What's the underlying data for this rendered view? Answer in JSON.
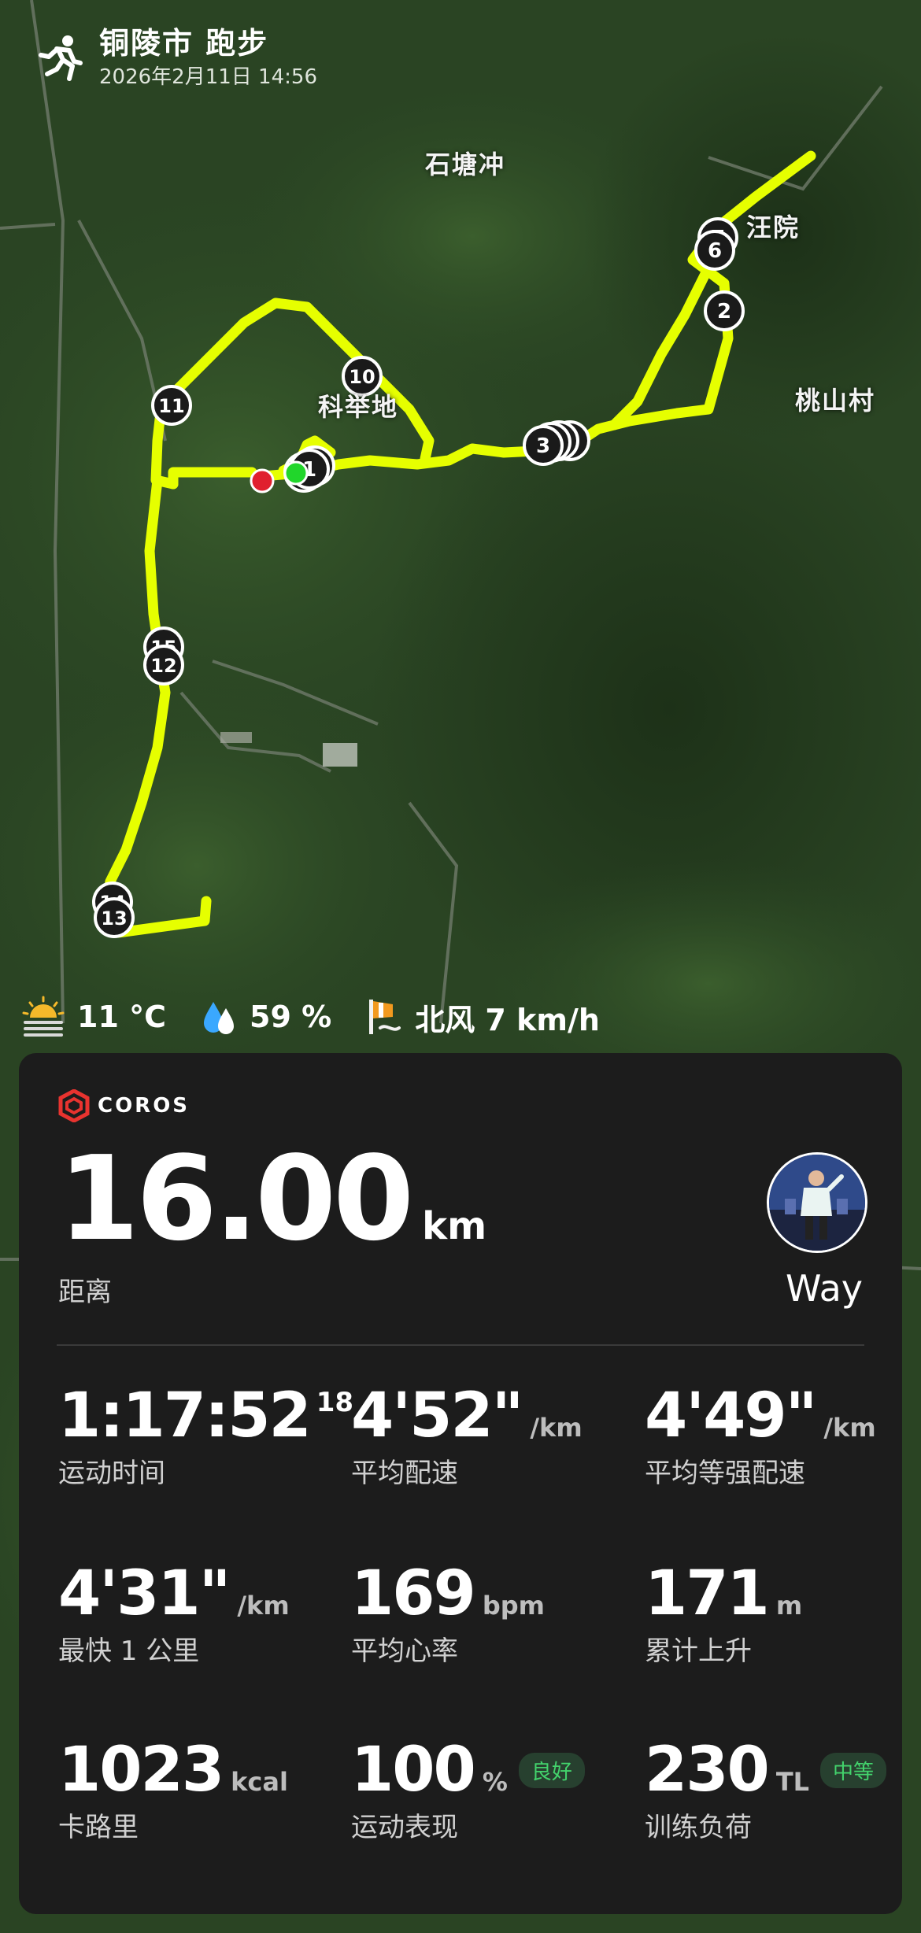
{
  "header": {
    "title": "铜陵市 跑步",
    "datetime": "2026年2月11日 14:56"
  },
  "map": {
    "place_names": [
      "石塘冲",
      "汪院",
      "桃山村",
      "科举地"
    ],
    "route_color": "#e6ff00",
    "markers": [
      "1",
      "2",
      "3",
      "4",
      "5",
      "6",
      "7",
      "8",
      "9",
      "10",
      "11",
      "12",
      "13",
      "14",
      "15",
      "16"
    ],
    "start_color": "#21d62b",
    "end_color": "#e0202e"
  },
  "weather": {
    "temperature": "11 °C",
    "humidity": "59 %",
    "wind": "北风 7 km/h"
  },
  "card": {
    "brand": "COROS",
    "distance_value": "16.00",
    "distance_unit": "km",
    "distance_label": "距离",
    "user_name": "Way",
    "stats": [
      {
        "value": "1:17:52",
        "sup": "18",
        "unit": "",
        "label": "运动时间"
      },
      {
        "value": "4'52\"",
        "unit": "/km",
        "label": "平均配速"
      },
      {
        "value": "4'49\"",
        "unit": "/km",
        "label": "平均等强配速"
      },
      {
        "value": "4'31\"",
        "unit": "/km",
        "label": "最快 1 公里"
      },
      {
        "value": "169",
        "unit": "bpm",
        "label": "平均心率"
      },
      {
        "value": "171",
        "unit": "m",
        "label": "累计上升"
      },
      {
        "value": "1023",
        "unit": "kcal",
        "label": "卡路里"
      },
      {
        "value": "100",
        "unit": "%",
        "badge": "良好",
        "label": "运动表现"
      },
      {
        "value": "230",
        "unit": "TL",
        "badge": "中等",
        "label": "训练负荷"
      }
    ]
  },
  "colors": {
    "card_bg": "#1c1c1c",
    "badge_green": "#43d36c",
    "brand_red": "#e8332f"
  }
}
